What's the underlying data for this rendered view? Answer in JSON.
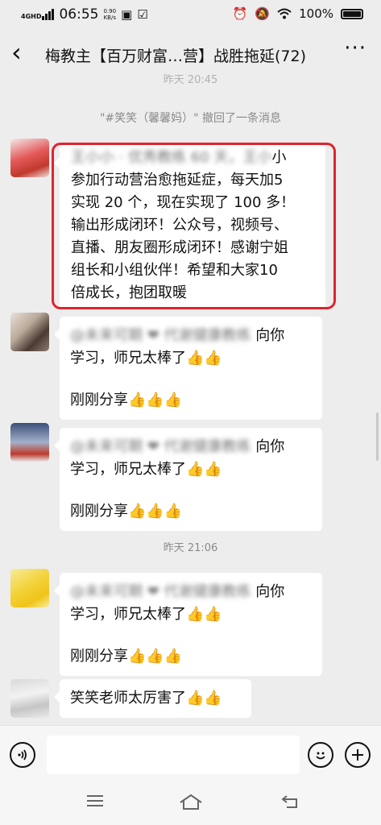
{
  "statusbar": {
    "network": "4GHD",
    "netspeed_value": "0.90",
    "netspeed_unit": "KB/s",
    "time": "06:55",
    "battery": "100%",
    "icons": [
      "signal-icon",
      "message-icon",
      "check-icon",
      "alarm-icon",
      "mute-icon",
      "wifi-icon",
      "battery-icon"
    ]
  },
  "header": {
    "title": "梅教主【百万财富…营】战胜拖延(72)",
    "back_icon": "back-chevron-icon",
    "more_icon": "more-dots-icon"
  },
  "chat": {
    "timestamp_top_partial": "昨天 20:45",
    "recall_notice": "\"#笑笑（馨馨妈）\" 撤回了一条消息",
    "timestamp_2": "昨天 21:06",
    "messages": [
      {
        "blurred_prefix": "王小小 · 优秀教练 60 天，王小",
        "lines": [
          "小",
          "参加行动营治愈拖延症，每天加5",
          "实现 20 个，现在实现了 100 多！",
          "输出形成闭环！公众号，视频号、",
          "直播、朋友圈形成闭环！感谢宁姐",
          "组长和小组伙伴！希望和大家10",
          "倍成长，抱团取暖"
        ]
      },
      {
        "blurred_prefix": "@未来可期 ❤ 代谢健康教练",
        "line1_end": "向你",
        "line2": "学习，师兄太棒了",
        "line2_emoji": "👍👍",
        "line3": "刚刚分享",
        "line3_emoji": "👍👍👍"
      },
      {
        "blurred_prefix": "@未来可期 ❤ 代谢健康教练",
        "line1_end": "向你",
        "line2": "学习，师兄太棒了",
        "line2_emoji": "👍👍",
        "line3": "刚刚分享",
        "line3_emoji": "👍👍👍"
      },
      {
        "blurred_prefix": "@未来可期 ❤ 代谢健康教练",
        "line1_end": "向你",
        "line2": "学习，师兄太棒了",
        "line2_emoji": "👍👍",
        "line3": "刚刚分享",
        "line3_emoji": "👍👍👍"
      },
      {
        "text": "笑笑老师太厉害了",
        "emoji": "👍👍"
      }
    ]
  },
  "inputbar": {
    "voice_icon": "voice-icon",
    "emoji_icon": "emoji-smile-icon",
    "plus_icon": "plus-icon",
    "placeholder": ""
  },
  "navbar": {
    "icons": [
      "menu-icon",
      "home-icon",
      "back-icon"
    ]
  },
  "colors": {
    "highlight": "#e0242d",
    "background": "#ededed"
  }
}
